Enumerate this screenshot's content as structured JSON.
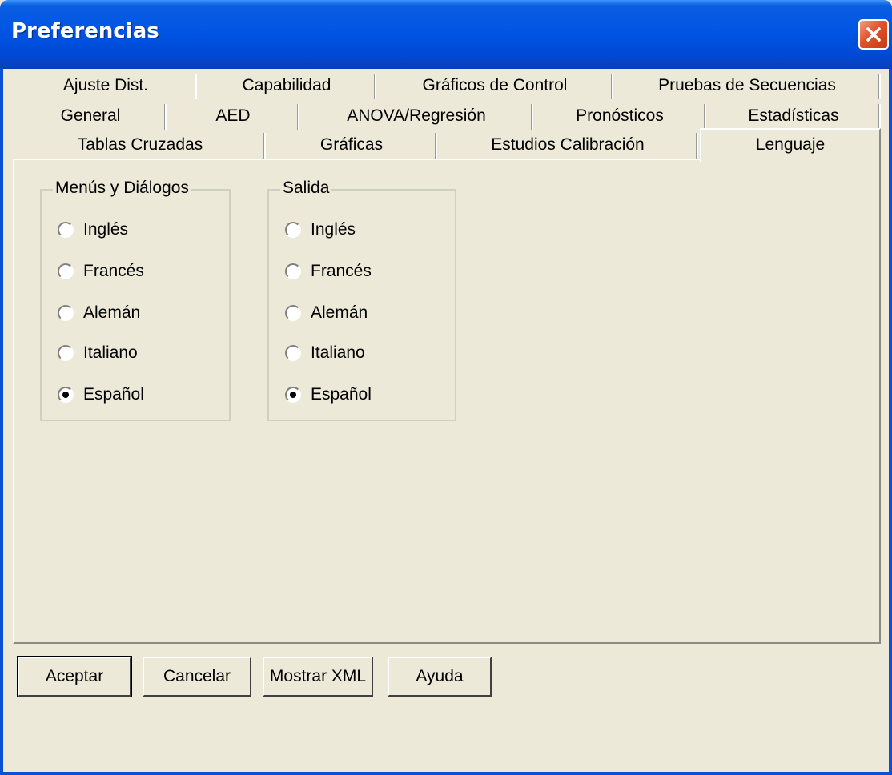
{
  "window": {
    "title": "Preferencias"
  },
  "tabs": {
    "row1": [
      "Ajuste Dist.",
      "Capabilidad",
      "Gráficos de Control",
      "Pruebas de Secuencias"
    ],
    "row2": [
      "General",
      "AED",
      "ANOVA/Regresión",
      "Pronósticos",
      "Estadísticas"
    ],
    "row3": [
      "Tablas Cruzadas",
      "Gráficas",
      "Estudios Calibración",
      "Lenguaje"
    ],
    "active": "Lenguaje"
  },
  "menus_group": {
    "legend": "Menús y Diálogos",
    "options": [
      "Inglés",
      "Francés",
      "Alemán",
      "Italiano",
      "Español"
    ],
    "selected": "Español"
  },
  "output_group": {
    "legend": "Salida",
    "options": [
      "Inglés",
      "Francés",
      "Alemán",
      "Italiano",
      "Español"
    ],
    "selected": "Español"
  },
  "buttons": {
    "ok": "Aceptar",
    "cancel": "Cancelar",
    "show_xml": "Mostrar XML",
    "help": "Ayuda"
  },
  "colors": {
    "title_bar": "#0055e5",
    "face": "#ece9d8",
    "close": "#e0522c"
  },
  "icons": {
    "close": "close-icon"
  }
}
